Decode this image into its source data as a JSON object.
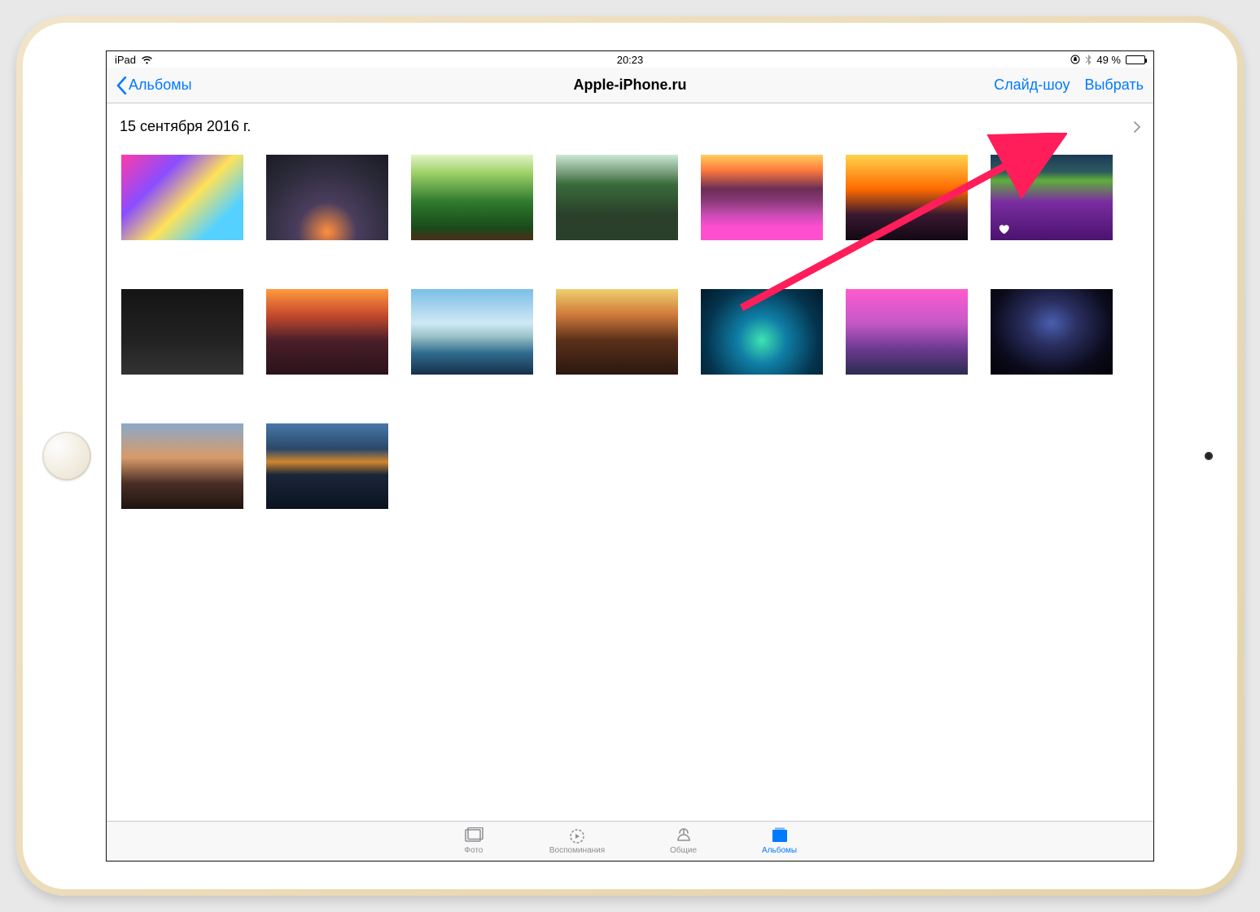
{
  "status": {
    "device": "iPad",
    "time": "20:23",
    "battery_percent": "49 %",
    "wifi_icon": "wifi",
    "orientation_lock": true,
    "bluetooth_icon": "bluetooth"
  },
  "nav": {
    "back_label": "Альбомы",
    "title": "Apple-iPhone.ru",
    "slideshow": "Слайд-шоу",
    "select": "Выбрать"
  },
  "section": {
    "date_header": "15 сентября 2016 г."
  },
  "photos": [
    {
      "name": "photo-clouds-colorful",
      "cls": "t01",
      "favorite": false
    },
    {
      "name": "photo-city-dusk",
      "cls": "t02",
      "favorite": false
    },
    {
      "name": "photo-forest-path",
      "cls": "t03",
      "favorite": false
    },
    {
      "name": "photo-forest-road",
      "cls": "t04",
      "favorite": false
    },
    {
      "name": "photo-mountain-flowers",
      "cls": "t05",
      "favorite": false
    },
    {
      "name": "photo-ocean-sunset",
      "cls": "t06",
      "favorite": false
    },
    {
      "name": "photo-lavender-field",
      "cls": "t07",
      "favorite": true
    },
    {
      "name": "photo-motorcycle-dark",
      "cls": "t08",
      "favorite": false
    },
    {
      "name": "photo-ocean-sunset-dark",
      "cls": "t09",
      "favorite": false
    },
    {
      "name": "photo-mountain-lake",
      "cls": "t10",
      "favorite": false
    },
    {
      "name": "photo-mountain-orange",
      "cls": "t11",
      "favorite": false
    },
    {
      "name": "photo-coral-reef",
      "cls": "t12",
      "favorite": false
    },
    {
      "name": "photo-mountain-pink",
      "cls": "t13",
      "favorite": false
    },
    {
      "name": "photo-milky-way",
      "cls": "t14",
      "favorite": false
    },
    {
      "name": "photo-volcano-fog",
      "cls": "t15",
      "favorite": false
    },
    {
      "name": "photo-mountain-reflection",
      "cls": "t16",
      "favorite": false
    }
  ],
  "tabs": [
    {
      "key": "photos",
      "label": "Фото",
      "active": false
    },
    {
      "key": "memories",
      "label": "Воспоминания",
      "active": false
    },
    {
      "key": "shared",
      "label": "Общие",
      "active": false
    },
    {
      "key": "albums",
      "label": "Альбомы",
      "active": true
    }
  ],
  "colors": {
    "tint": "#007aff",
    "annotation": "#ff1e5a"
  }
}
